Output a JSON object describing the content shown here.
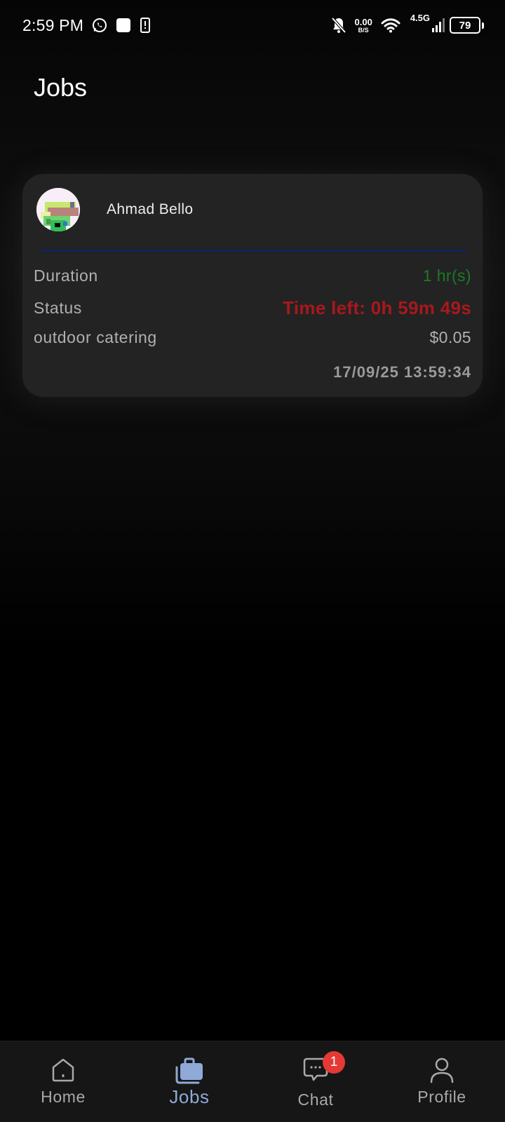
{
  "status_bar": {
    "time": "2:59 PM",
    "net_speed_value": "0.00",
    "net_speed_unit": "B/S",
    "network_type": "4.5G",
    "battery_level": "79",
    "icons": [
      "whatsapp-icon",
      "app-square-icon",
      "phone-alert-icon",
      "bell-off-icon",
      "wifi-icon",
      "signal-icon",
      "battery-icon"
    ]
  },
  "page": {
    "title": "Jobs"
  },
  "job_card": {
    "client_name": "Ahmad Bello",
    "duration_label": "Duration",
    "duration_value": "1 hr(s)",
    "status_label": "Status",
    "status_value": "Time left: 0h 59m 49s",
    "category_label": "outdoor catering",
    "price_value": "$0.05",
    "timestamp": "17/09/25 13:59:34"
  },
  "colors": {
    "background": "#000000",
    "card": "#232323",
    "divider": "#13235a",
    "duration_green": "#1c7a26",
    "status_red": "#a8181d",
    "nav_active": "#8fa9d8",
    "badge": "#e53935"
  },
  "bottom_nav": {
    "items": [
      {
        "label": "Home",
        "icon": "home-icon"
      },
      {
        "label": "Jobs",
        "icon": "briefcase-icon",
        "active": true
      },
      {
        "label": "Chat",
        "icon": "chat-icon",
        "badge": "1"
      },
      {
        "label": "Profile",
        "icon": "person-icon"
      }
    ]
  }
}
